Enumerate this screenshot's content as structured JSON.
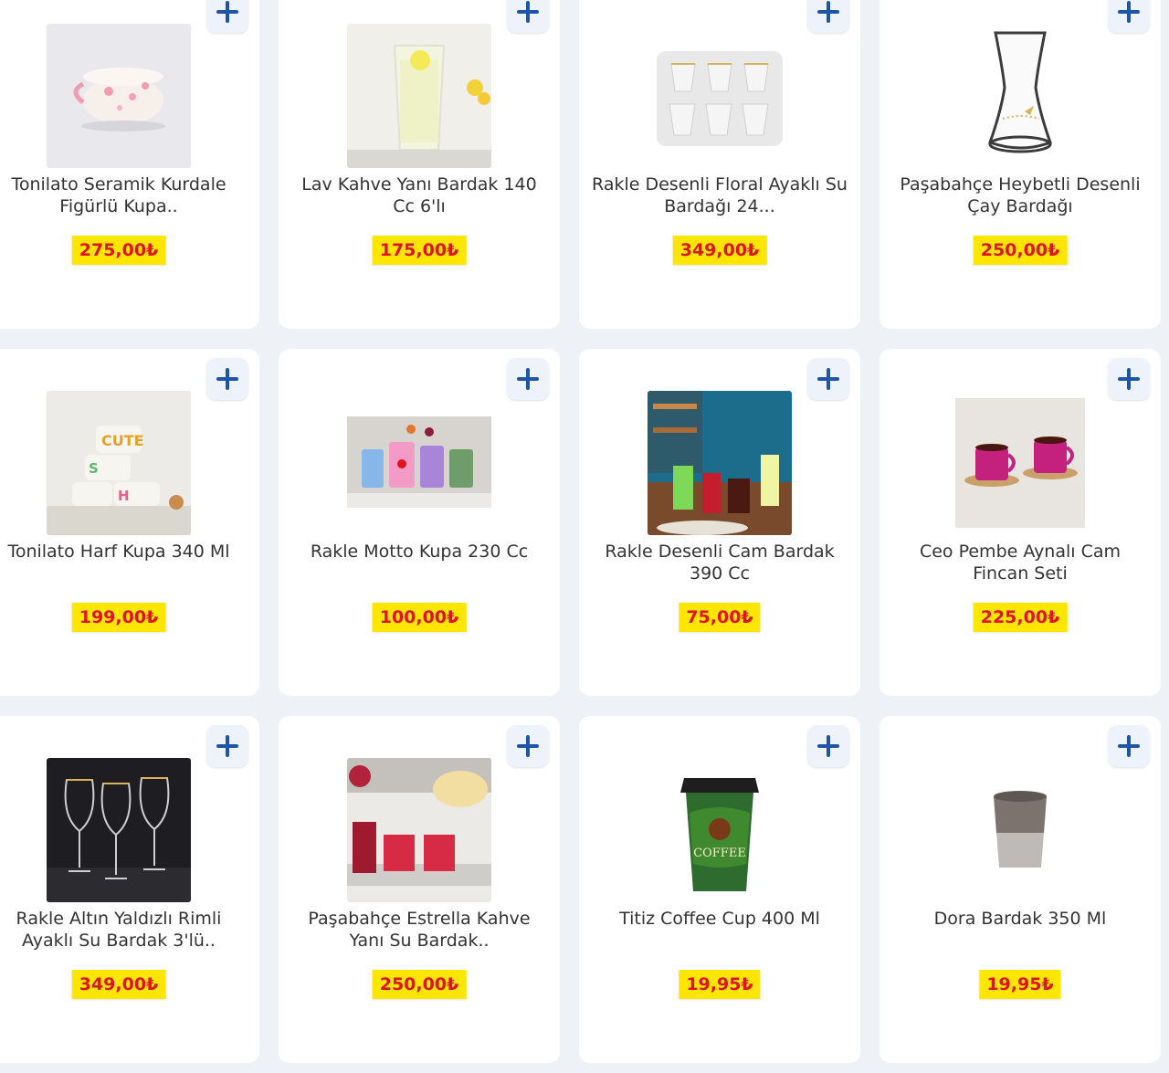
{
  "products": [
    {
      "title": "Tonilato Seramik Kurdale Figürlü Kupa..",
      "price": "275,00₺",
      "image_icon": "pink-ceramic-mug-image"
    },
    {
      "title": "Lav Kahve Yanı Bardak 140 Cc 6'lı",
      "price": "175,00₺",
      "image_icon": "lemon-water-glass-image"
    },
    {
      "title": "Rakle Desenli Floral Ayaklı Su Bardağı 24...",
      "price": "349,00₺",
      "image_icon": "floral-stemmed-glasses-image"
    },
    {
      "title": "Paşabahçe Heybetli Desenli Çay Bardağı",
      "price": "250,00₺",
      "image_icon": "tea-glass-image"
    },
    {
      "title": "Tonilato Harf Kupa 340 Ml",
      "price": "199,00₺",
      "image_icon": "letter-mugs-image"
    },
    {
      "title": "Rakle Motto Kupa 230 Cc",
      "price": "100,00₺",
      "image_icon": "colorful-mugs-image"
    },
    {
      "title": "Rakle Desenli Cam Bardak 390 Cc",
      "price": "75,00₺",
      "image_icon": "drink-glasses-image"
    },
    {
      "title": "Ceo Pembe Aynalı Cam Fincan Seti",
      "price": "225,00₺",
      "image_icon": "pink-cups-image"
    },
    {
      "title": "Rakle Altın Yaldızlı Rimli Ayaklı Su Bardak 3'lü..",
      "price": "349,00₺",
      "image_icon": "wine-glasses-image"
    },
    {
      "title": "Paşabahçe Estrella Kahve Yanı Su Bardak..",
      "price": "250,00₺",
      "image_icon": "juice-glasses-image"
    },
    {
      "title": "Titiz Coffee Cup 400 Ml",
      "price": "19,95₺",
      "image_icon": "coffee-cup-image"
    },
    {
      "title": "Dora Bardak 350 Ml",
      "price": "19,95₺",
      "image_icon": "grey-cup-image"
    }
  ],
  "theme": {
    "price_bg": "#ffe600",
    "price_text": "#e0121f",
    "add_icon": "#1d56a8"
  }
}
